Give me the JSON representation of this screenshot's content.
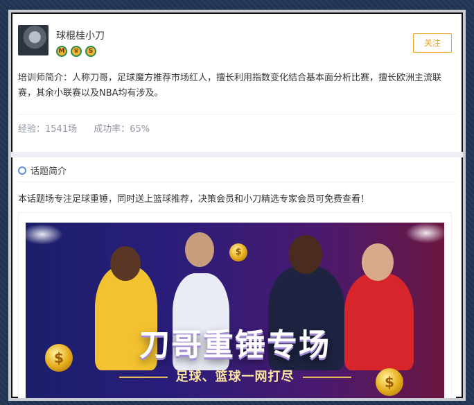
{
  "expert": {
    "name": "球棍桂小刀",
    "badges": [
      "M",
      "♛",
      "S"
    ],
    "follow_label": "关注",
    "intro": "培训师简介：人称刀哥，足球魔方推荐市场红人，擅长利用指数变化结合基本面分析比赛，擅长欧洲主流联赛，其余小联赛以及NBA均有涉及。",
    "experience": "经验：1541场",
    "success_rate": "成功率：65%"
  },
  "topic": {
    "title": "话题简介",
    "description": "本话题场专注足球重锤，同时送上篮球推荐，决策会员和小刀精选专家会员可免费查看！"
  },
  "banner": {
    "title": "刀哥重锤专场",
    "subtitle": "足球、篮球一网打尽"
  },
  "colors": {
    "accent": "#f0a020",
    "stat_text": "#8f96a3",
    "banner_start": "#1b1f6b",
    "banner_end": "#6a1640"
  }
}
